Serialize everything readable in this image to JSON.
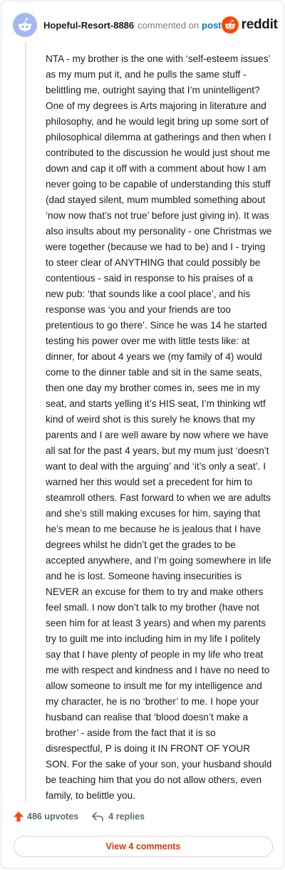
{
  "header": {
    "username": "Hopeful-Resort-8886",
    "commented_on": "commented on",
    "post_link": "post",
    "brand": "reddit"
  },
  "comment": {
    "text": "NTA - my brother is the one with ‘self-esteem issues’ as my mum put it, and he pulls the same stuff - belittling me, outright saying that I’m unintelligent? One of my degrees is Arts majoring in literature and philosophy, and he would legit bring up some sort of philosophical dilemma at gatherings and then when I contributed to the discussion he would just shout me down and cap it off with a comment about how I am never going to be capable of understanding this stuff (dad stayed silent, mum mumbled something about ‘now now that’s not true’ before just giving in). It was also insults about my personality - one Christmas we were together (because we had to be) and I - trying to steer clear of ANYTHING that could possibly be contentious - said in response to his praises of a new pub: ‘that sounds like a cool place’, and his response was ‘you and your friends are too pretentious to go there’. Since he was 14 he started testing his power over me with little tests like: at dinner, for about 4 years we (my family of 4) would come to the dinner table and sit in the same seats, then one day my brother comes in, sees me in my seat, and starts yelling it’s HIS seat, I’m thinking wtf kind of weird shot is this surely he knows that my parents and I are well aware by now where we have all sat for the past 4 years, but my mum just ‘doesn’t want to deal with the arguing’ and ‘it’s only a seat’. I warned her this would set a precedent for him to steamroll others. Fast forward to when we are adults and she’s still making excuses for him, saying that he’s mean to me because he is jealous that I have degrees whilst he didn’t get the grades to be accepted anywhere, and I’m going somewhere in life and he is lost. Someone having insecurities is NEVER an excuse for them to try and make others feel small. I now don’t talk to my brother (have not seen him for at least 3 years) and when my parents try to guilt me into including him in my life I politely say that I have plenty of people in my life who treat me with respect and kindness and I have no need to allow someone to insult me for my intelligence and my character, he is no ‘brother’ to me. I hope your husband can realise that ‘blood doesn’t make a brother’ - aside from the fact that it is so disrespectful, P is doing it IN FRONT OF YOUR SON. For the sake of your son, your husband should be teaching him that you do not allow others, even family, to belittle you."
  },
  "footer": {
    "upvotes": "486 upvotes",
    "replies": "4 replies",
    "view_comments": "View 4 comments"
  },
  "colors": {
    "brand_orange": "#ff4500",
    "link_blue": "#0079d3",
    "avatar_bg": "#a3b7f2"
  },
  "icons": {
    "avatar": "snoo-avatar-icon",
    "logo": "reddit-logo-icon",
    "upvote": "upvote-arrow-icon",
    "reply": "reply-arrow-icon"
  }
}
